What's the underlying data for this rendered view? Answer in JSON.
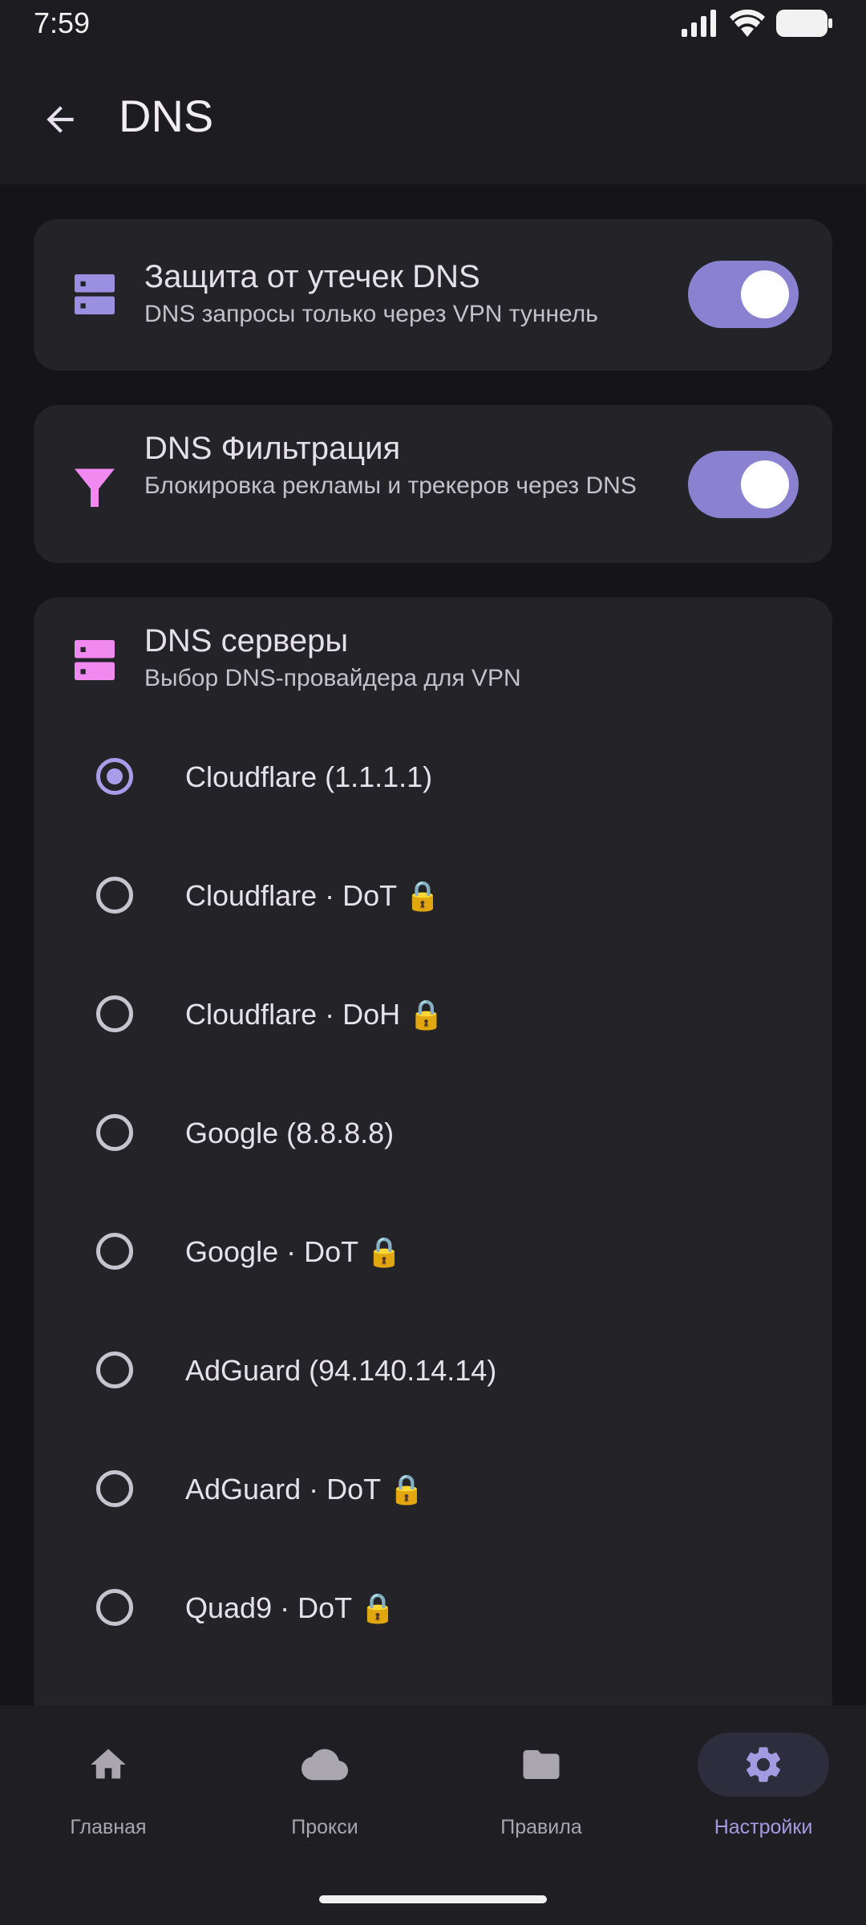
{
  "status_bar": {
    "time": "7:59"
  },
  "app_bar": {
    "title": "DNS"
  },
  "leak_card": {
    "title": "Защита от утечек DNS",
    "subtitle": "DNS запросы только через VPN туннель",
    "enabled": true,
    "icon": "server-icon"
  },
  "filter_card": {
    "title": "DNS Фильтрация",
    "subtitle": "Блокировка рекламы и трекеров через DNS",
    "enabled": true,
    "icon": "filter-icon"
  },
  "servers_card": {
    "title": "DNS серверы",
    "subtitle": "Выбор DNS-провайдера для VPN",
    "icon": "server-icon",
    "selected_index": 0,
    "options": [
      {
        "label": "Cloudflare (1.1.1.1)"
      },
      {
        "label": "Cloudflare · DoT 🔒"
      },
      {
        "label": "Cloudflare · DoH 🔒"
      },
      {
        "label": "Google (8.8.8.8)"
      },
      {
        "label": "Google · DoT 🔒"
      },
      {
        "label": "AdGuard (94.140.14.14)"
      },
      {
        "label": "AdGuard · DoT 🔒"
      },
      {
        "label": "Quad9 · DoT 🔒"
      }
    ]
  },
  "bottom_nav": {
    "items": [
      {
        "label": "Главная",
        "icon": "home-icon"
      },
      {
        "label": "Прокси",
        "icon": "cloud-icon"
      },
      {
        "label": "Правила",
        "icon": "folder-icon"
      },
      {
        "label": "Настройки",
        "icon": "gear-icon"
      }
    ],
    "active_index": 3
  },
  "colors": {
    "accent": "#8b81d1",
    "accent_light": "#a79de8",
    "icon_purple": "#9a8fe0",
    "icon_pink": "#f089f0",
    "background": "#151518",
    "card": "#232328"
  }
}
